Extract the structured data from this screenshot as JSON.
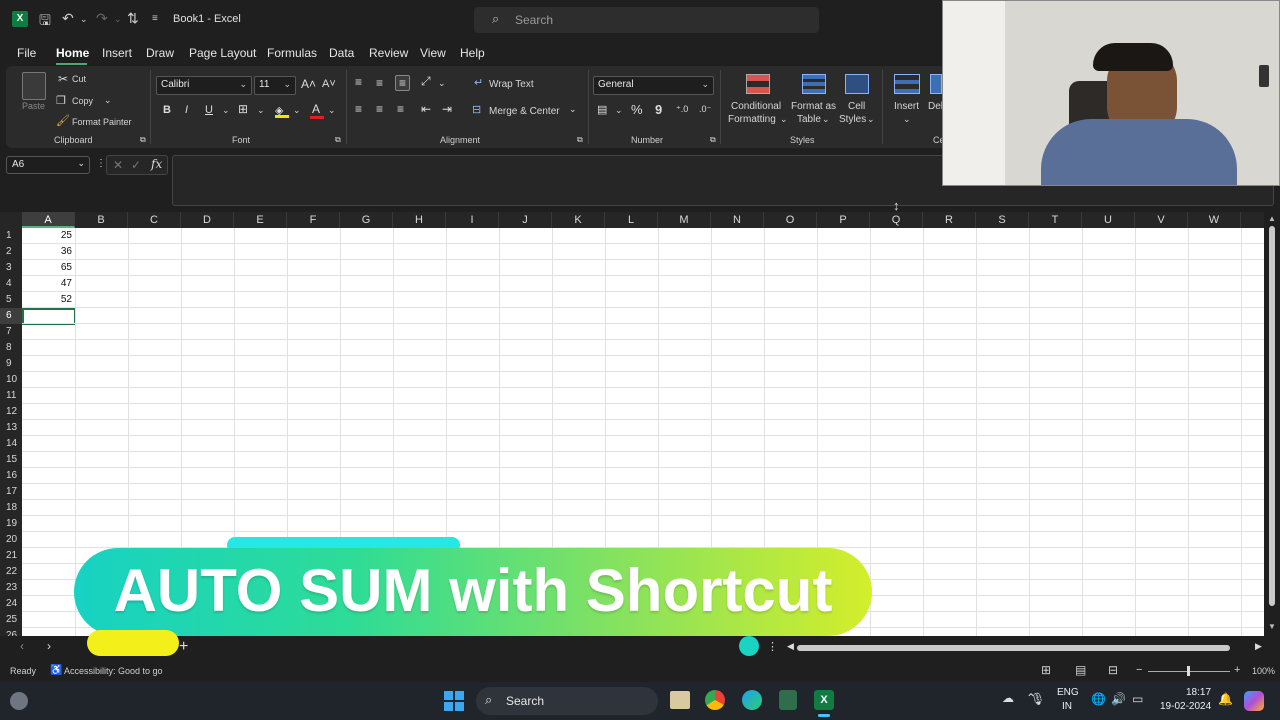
{
  "titlebar": {
    "doc_title": "Book1  -  Excel",
    "search_placeholder": "Search"
  },
  "menu": [
    "File",
    "Home",
    "Insert",
    "Draw",
    "Page Layout",
    "Formulas",
    "Data",
    "Review",
    "View",
    "Help"
  ],
  "ribbon": {
    "clipboard": {
      "paste": "Paste",
      "cut": "Cut",
      "copy": "Copy",
      "format_painter": "Format Painter",
      "group": "Clipboard"
    },
    "font": {
      "name": "Calibri",
      "size": "11",
      "group": "Font",
      "bold": "B",
      "italic": "I",
      "underline": "U",
      "grow": "A˄",
      "shrink": "A˅"
    },
    "alignment": {
      "wrap": "Wrap Text",
      "merge": "Merge & Center",
      "group": "Alignment"
    },
    "number": {
      "format": "General",
      "percent": "%",
      "comma": "9",
      "group": "Number"
    },
    "styles": {
      "cond1": "Conditional",
      "cond2": "Formatting",
      "fmt1": "Format as",
      "fmt2": "Table",
      "cell1": "Cell",
      "cell2": "Styles",
      "group": "Styles"
    },
    "cells": {
      "insert": "Insert",
      "delete": "Del",
      "group": "Ce"
    }
  },
  "formula_bar": {
    "name_box": "A6",
    "fx": "fx",
    "cancel": "✕",
    "enter": "✓",
    "value": ""
  },
  "columns": [
    "A",
    "B",
    "C",
    "D",
    "E",
    "F",
    "G",
    "H",
    "I",
    "J",
    "K",
    "L",
    "M",
    "N",
    "O",
    "P",
    "Q",
    "R",
    "S",
    "T",
    "U",
    "V",
    "W"
  ],
  "rows": [
    "1",
    "2",
    "3",
    "4",
    "5",
    "6",
    "7",
    "8",
    "9",
    "10",
    "11",
    "12",
    "13",
    "14",
    "15",
    "16",
    "17",
    "18",
    "19",
    "20",
    "21",
    "22",
    "23",
    "24",
    "25",
    "26"
  ],
  "cells": {
    "A1": "25",
    "A2": "36",
    "A3": "65",
    "A4": "47",
    "A5": "52"
  },
  "banner": {
    "text": "AUTO SUM with Shortcut"
  },
  "sheet": {
    "add": "+",
    "prev": "‹",
    "next": "›",
    "more": "⋮"
  },
  "status": {
    "ready": "Ready",
    "accessibility": "Accessibility: Good to go",
    "zoom": "100%",
    "zoom_minus": "−",
    "zoom_plus": "+"
  },
  "taskbar": {
    "search": "Search",
    "lang1": "ENG",
    "lang2": "IN",
    "time": "18:17",
    "date": "19-02-2024"
  },
  "colors": {
    "accent": "#217346",
    "banner_start": "#17d2c3",
    "banner_end": "#d4ee2a",
    "ribbon": "#2b2b2b"
  }
}
